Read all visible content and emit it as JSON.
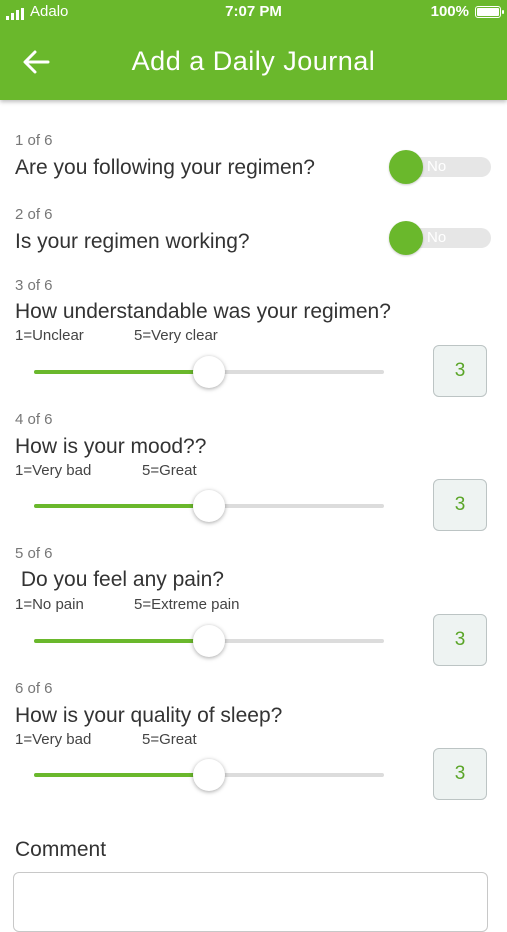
{
  "status_bar": {
    "carrier": "Adalo",
    "time": "7:07 PM",
    "battery": "100%"
  },
  "header": {
    "title": "Add a Daily Journal"
  },
  "questions": [
    {
      "step": "1 of 6",
      "text": "Are you following your regimen?",
      "toggle_label": "No",
      "toggle_on": false
    },
    {
      "step": "2 of 6",
      "text": "Is your regimen working?",
      "toggle_label": "No",
      "toggle_on": false
    },
    {
      "step": "3 of 6",
      "text": "How understandable was your regimen?",
      "min_label": "1=Unclear",
      "max_label": "5=Very clear",
      "value": "3",
      "slider_value": 3,
      "slider_min": 1,
      "slider_max": 5
    },
    {
      "step": "4 of 6",
      "text": "How is your mood??",
      "min_label": "1=Very bad",
      "max_label": "5=Great",
      "value": "3",
      "slider_value": 3,
      "slider_min": 1,
      "slider_max": 5
    },
    {
      "step": "5 of 6",
      "text": " Do you feel any pain?",
      "min_label": "1=No pain",
      "max_label": "5=Extreme pain",
      "value": "3",
      "slider_value": 3,
      "slider_min": 1,
      "slider_max": 5
    },
    {
      "step": "6 of 6",
      "text": "How is your quality of sleep?",
      "min_label": "1=Very bad",
      "max_label": "5=Great",
      "value": "3",
      "slider_value": 3,
      "slider_min": 1,
      "slider_max": 5
    }
  ],
  "comment": {
    "label": "Comment",
    "value": ""
  },
  "colors": {
    "accent": "#6ab82c",
    "value_text": "#5aa528"
  },
  "icons": {
    "back": "arrow-left-icon",
    "signal": "signal-icon",
    "battery": "battery-icon"
  }
}
